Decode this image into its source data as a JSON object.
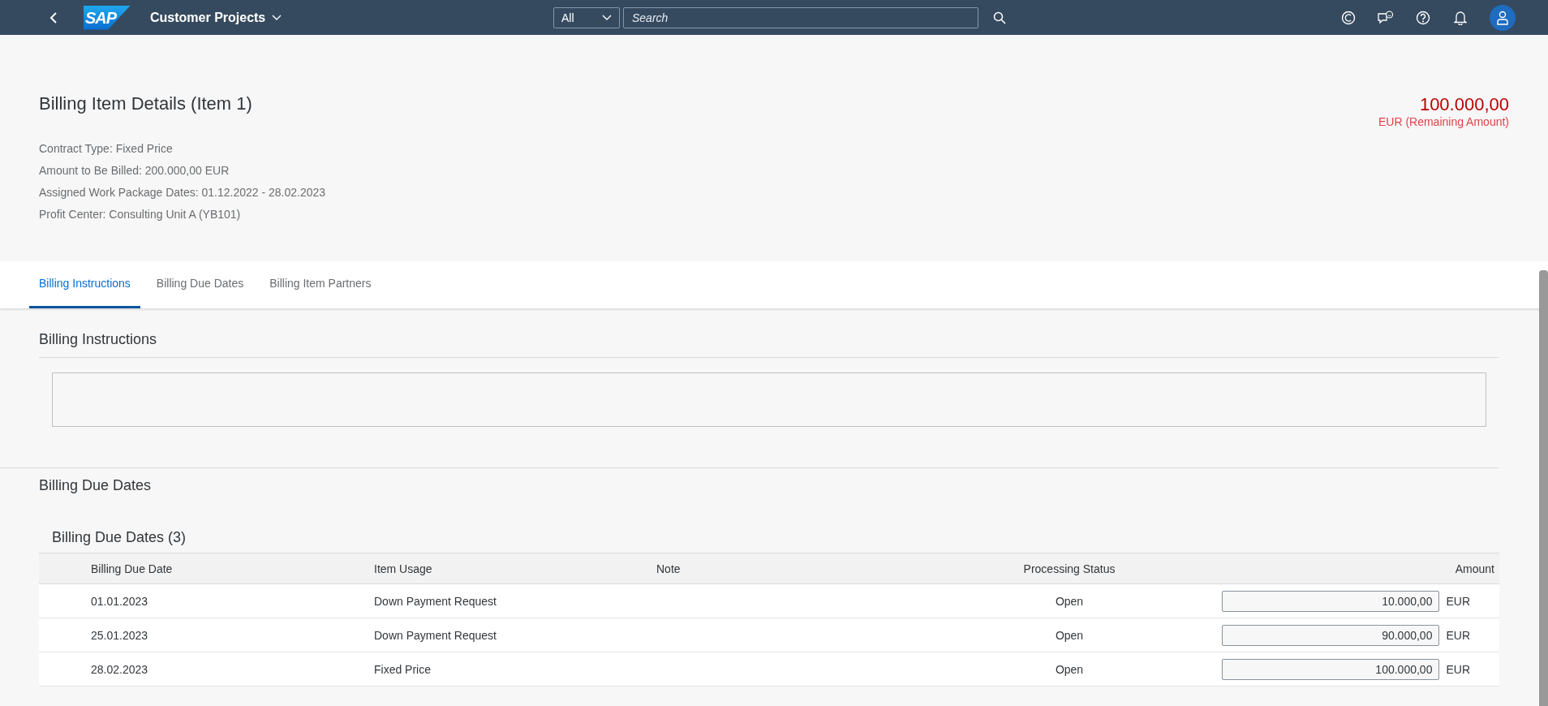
{
  "shell_bar": {
    "logo_text": "SAP",
    "app_title": "Customer Projects",
    "search_scope": "All",
    "search": {
      "placeholder": "Search"
    }
  },
  "header": {
    "title": "Billing Item Details (Item 1)",
    "attributes": [
      {
        "text": "Contract Type: Fixed Price"
      },
      {
        "text": "Amount to Be Billed: 200.000,00 EUR"
      },
      {
        "text": "Assigned Work Package Dates: 01.12.2022 - 28.02.2023"
      },
      {
        "text": "Profit Center: Consulting Unit A (YB101)"
      }
    ],
    "key_figure": {
      "value": "100.000,00",
      "unit": "EUR (Remaining Amount)"
    }
  },
  "tabs": [
    {
      "label": "Billing Instructions",
      "selected": true
    },
    {
      "label": "Billing Due Dates",
      "selected": false
    },
    {
      "label": "Billing Item Partners",
      "selected": false
    }
  ],
  "sections": [
    {
      "title": "Billing Instructions",
      "kind": "text"
    },
    {
      "title": "Billing Due Dates",
      "kind": "table",
      "table": {
        "title": "Billing Due Dates (3)",
        "columns": [
          {
            "label": "Billing Due Date"
          },
          {
            "label": "Item Usage"
          },
          {
            "label": "Note"
          },
          {
            "label": "Processing Status"
          },
          {
            "label": "Amount"
          }
        ],
        "rows": [
          {
            "due_date": "01.01.2023",
            "usage": "Down Payment Request",
            "status": "Open",
            "amount": "10.000,00",
            "currency": "EUR"
          },
          {
            "due_date": "25.01.2023",
            "usage": "Down Payment Request",
            "status": "Open",
            "amount": "90.000,00",
            "currency": "EUR"
          },
          {
            "due_date": "28.02.2023",
            "usage": "Fixed Price",
            "status": "Open",
            "amount": "100.000,00",
            "currency": "EUR"
          }
        ]
      }
    }
  ]
}
